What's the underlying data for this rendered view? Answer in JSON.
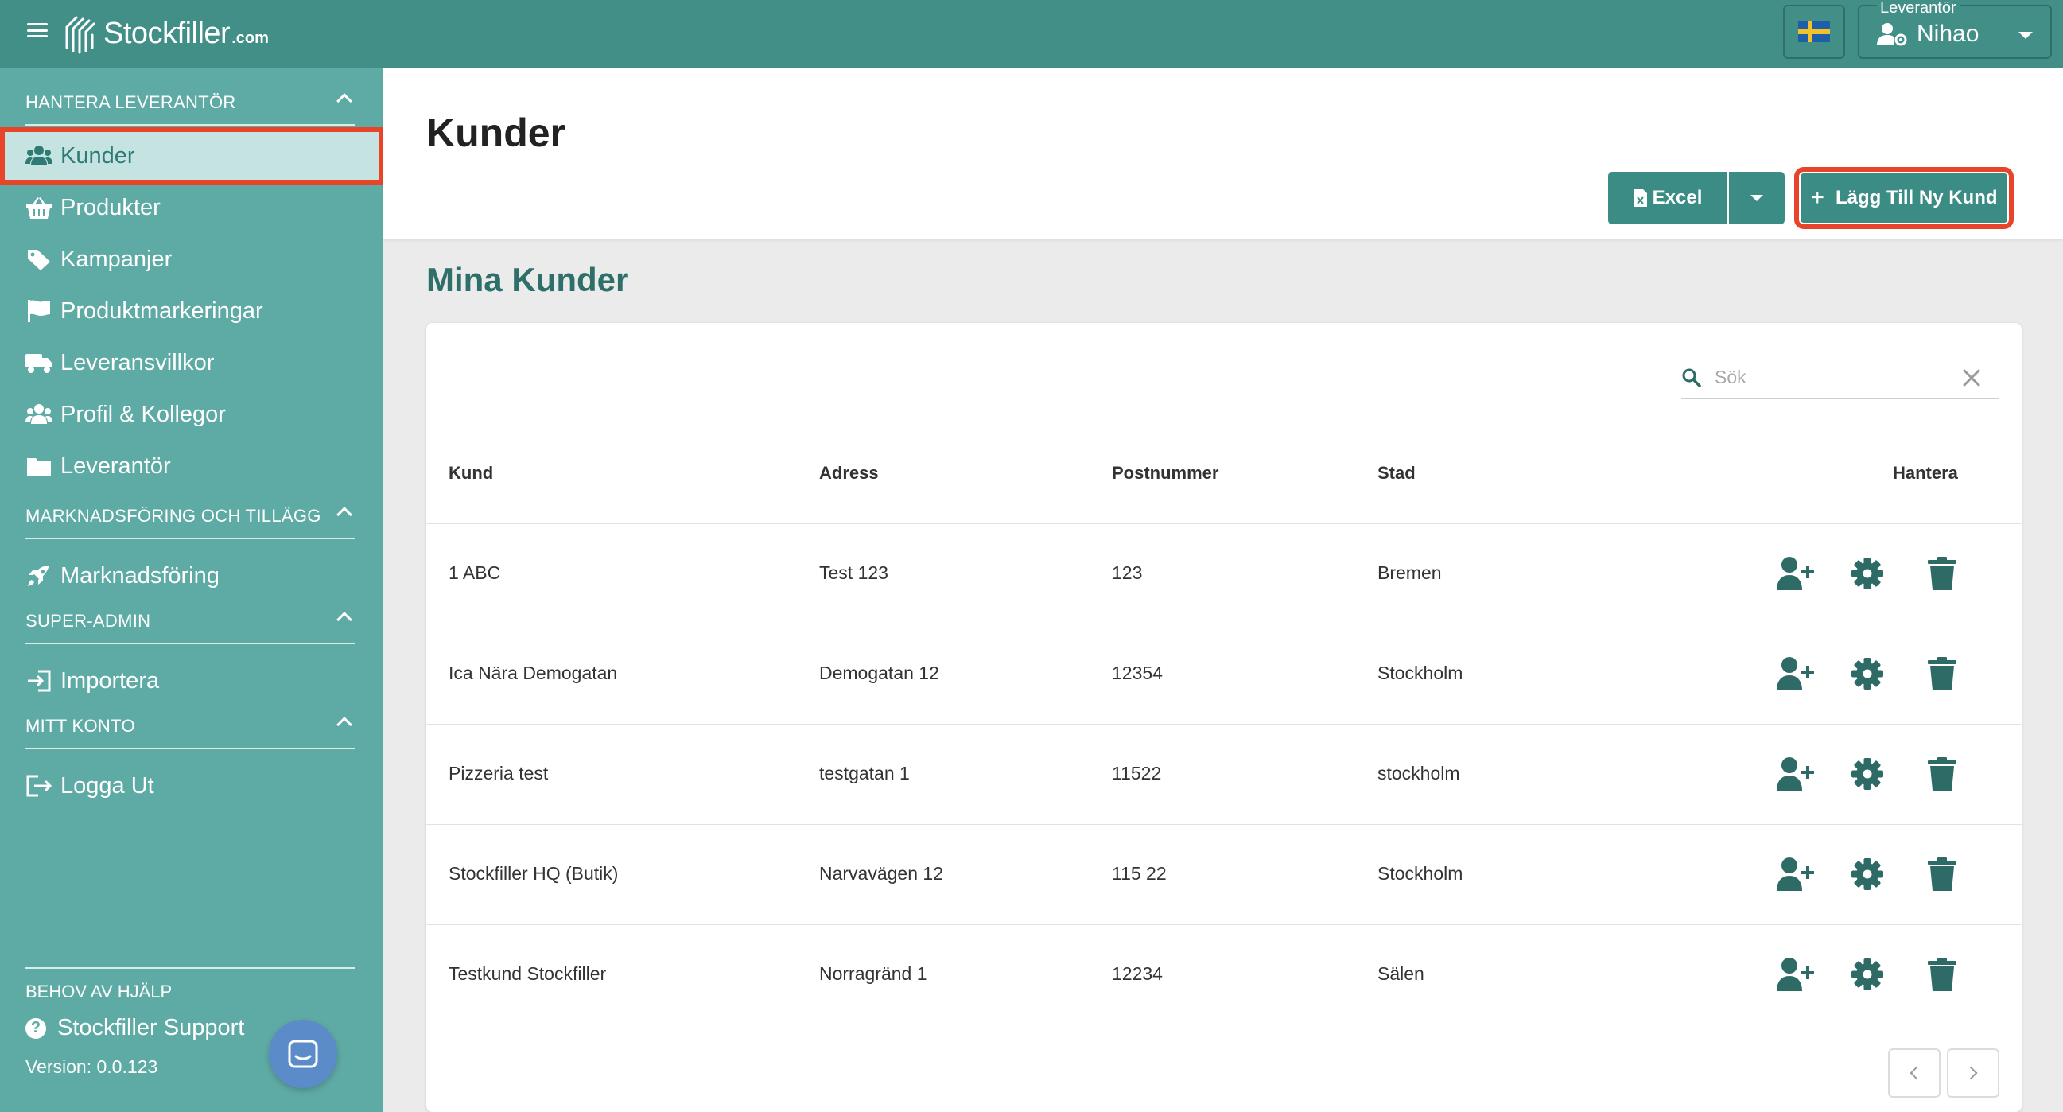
{
  "topbar": {
    "logo_text": "Stockfiller",
    "logo_suffix": ".com",
    "supplier_label": "Leverantör",
    "supplier_value": "Nihao"
  },
  "sidebar": {
    "sections": [
      {
        "title": "HANTERA LEVERANTÖR"
      },
      {
        "title": "MARKNADSFÖRING OCH TILLÄGG"
      },
      {
        "title": "SUPER-ADMIN"
      },
      {
        "title": "MITT KONTO"
      }
    ],
    "items": [
      {
        "label": "Kunder",
        "icon": "users-icon"
      },
      {
        "label": "Produkter",
        "icon": "basket-icon"
      },
      {
        "label": "Kampanjer",
        "icon": "tag-icon"
      },
      {
        "label": "Produktmarkeringar",
        "icon": "flag-icon"
      },
      {
        "label": "Leveransvillkor",
        "icon": "truck-icon"
      },
      {
        "label": "Profil & Kollegor",
        "icon": "users-icon"
      },
      {
        "label": "Leverantör",
        "icon": "folder-icon"
      },
      {
        "label": "Marknadsföring",
        "icon": "rocket-icon"
      },
      {
        "label": "Importera",
        "icon": "sign-in-icon"
      },
      {
        "label": "Logga Ut",
        "icon": "sign-out-icon"
      }
    ],
    "help_title": "BEHOV AV HJÄLP",
    "support_label": "Stockfiller Support",
    "version": "Version: 0.0.123"
  },
  "header": {
    "title": "Kunder",
    "excel_label": "Excel",
    "add_label": "Lägg Till Ny Kund"
  },
  "main": {
    "section_title": "Mina Kunder",
    "search_placeholder": "Sök",
    "columns": [
      "Kund",
      "Adress",
      "Postnummer",
      "Stad",
      "Hantera"
    ],
    "rows": [
      {
        "kund": "1 ABC",
        "adress": "Test 123",
        "postnummer": "123",
        "stad": "Bremen"
      },
      {
        "kund": "Ica Nära Demogatan",
        "adress": "Demogatan 12",
        "postnummer": "12354",
        "stad": "Stockholm"
      },
      {
        "kund": "Pizzeria test",
        "adress": "testgatan 1",
        "postnummer": "11522",
        "stad": "stockholm"
      },
      {
        "kund": "Stockfiller HQ (Butik)",
        "adress": "Narvavägen 12",
        "postnummer": "115 22",
        "stad": "Stockholm"
      },
      {
        "kund": "Testkund Stockfiller",
        "adress": "Norragränd 1",
        "postnummer": "12234",
        "stad": "Sälen"
      }
    ]
  },
  "colors": {
    "topbar": "#428f88",
    "sidebar": "#5eaba5",
    "accent": "#3a8c84",
    "highlight": "#e8442a",
    "icon": "#2f6b66"
  }
}
